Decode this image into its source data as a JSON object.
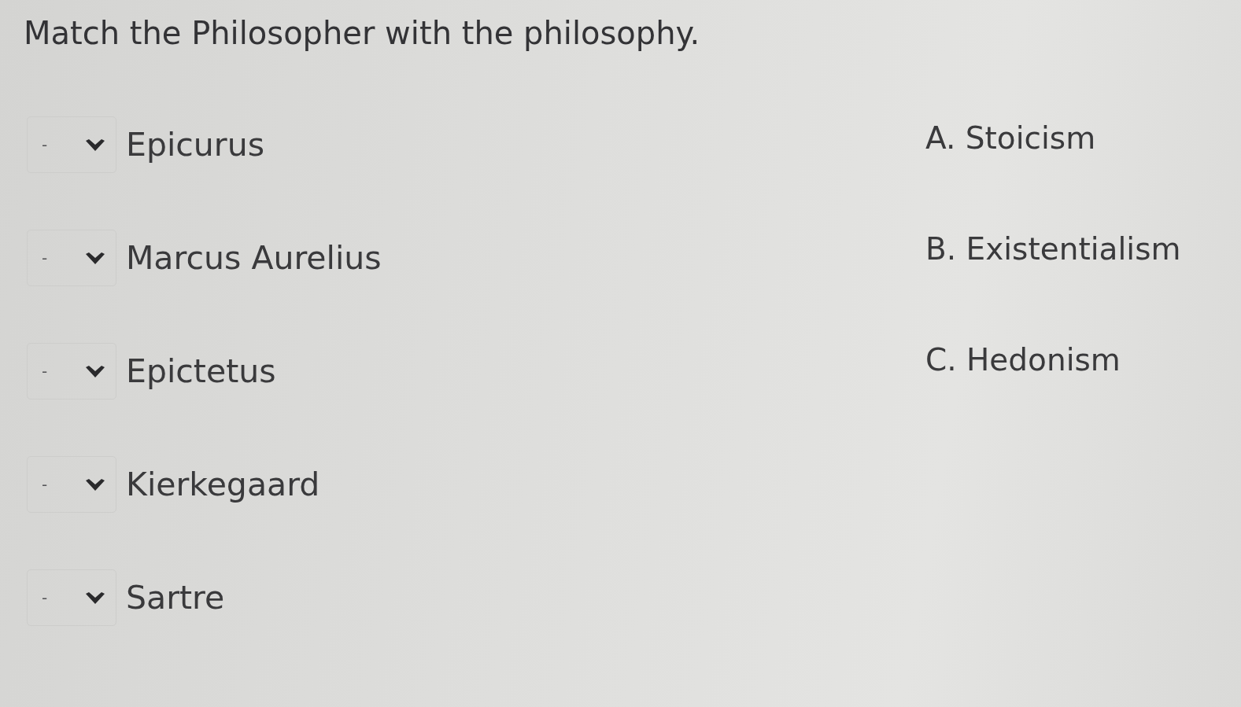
{
  "title": "Match the Philosopher with the philosophy.",
  "matches": [
    {
      "selection": "-",
      "philosopher": "Epicurus"
    },
    {
      "selection": "-",
      "philosopher": "Marcus Aurelius"
    },
    {
      "selection": "-",
      "philosopher": "Epictetus"
    },
    {
      "selection": "-",
      "philosopher": "Kierkegaard"
    },
    {
      "selection": "-",
      "philosopher": "Sartre"
    }
  ],
  "options": [
    {
      "text": "A. Stoicism"
    },
    {
      "text": "B. Existentialism"
    },
    {
      "text": "C. Hedonism"
    }
  ]
}
